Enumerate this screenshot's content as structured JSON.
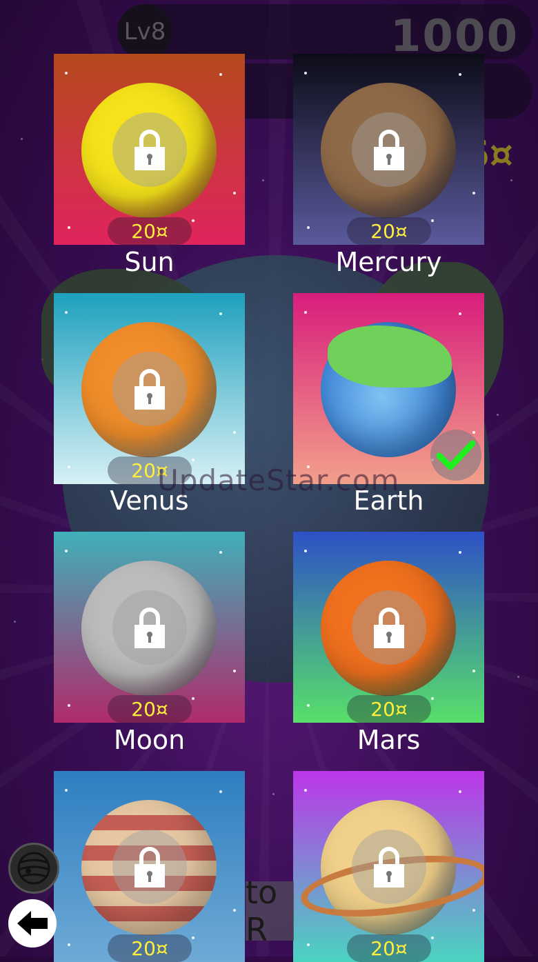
{
  "hud": {
    "level": "Lv8",
    "score": "1000",
    "coins_partial": "6¤"
  },
  "planets": [
    {
      "name": "Sun",
      "price": "20¤",
      "locked": true,
      "selected": false,
      "bg": [
        "#b5491c",
        "#e0245e"
      ],
      "color": "#f5e21a"
    },
    {
      "name": "Mercury",
      "price": "20¤",
      "locked": true,
      "selected": false,
      "bg": [
        "#0c0c18",
        "#5a5a9c"
      ],
      "color": "#8f6a48"
    },
    {
      "name": "Venus",
      "price": "20¤",
      "locked": true,
      "selected": false,
      "bg": [
        "#1ea0bd",
        "#d7f0f5"
      ],
      "color": "#f08d2a"
    },
    {
      "name": "Earth",
      "price": "",
      "locked": false,
      "selected": true,
      "bg": [
        "#d81d7c",
        "#f2a08a"
      ],
      "color": "#3e8ad8"
    },
    {
      "name": "Moon",
      "price": "20¤",
      "locked": true,
      "selected": false,
      "bg": [
        "#40b0ba",
        "#b02a6a"
      ],
      "color": "#bcbcbc"
    },
    {
      "name": "Mars",
      "price": "20¤",
      "locked": true,
      "selected": false,
      "bg": [
        "#2e50c6",
        "#58e06a"
      ],
      "color": "#f0701e"
    },
    {
      "name": "",
      "price": "20¤",
      "locked": true,
      "selected": false,
      "bg": [
        "#2e7ec0",
        "#6faad6"
      ],
      "color": "#d88a6e"
    },
    {
      "name": "",
      "price": "20¤",
      "locked": true,
      "selected": false,
      "bg": [
        "#bc36e8",
        "#4ad4c0"
      ],
      "color": "#f0d08a"
    }
  ],
  "watermark": "UpdateStar.com",
  "bottom_button_partial": "to R",
  "icons": {
    "lock": "lock-icon",
    "check": "checkmark-icon",
    "back": "back-arrow-icon",
    "menu": "planet-menu-icon"
  }
}
